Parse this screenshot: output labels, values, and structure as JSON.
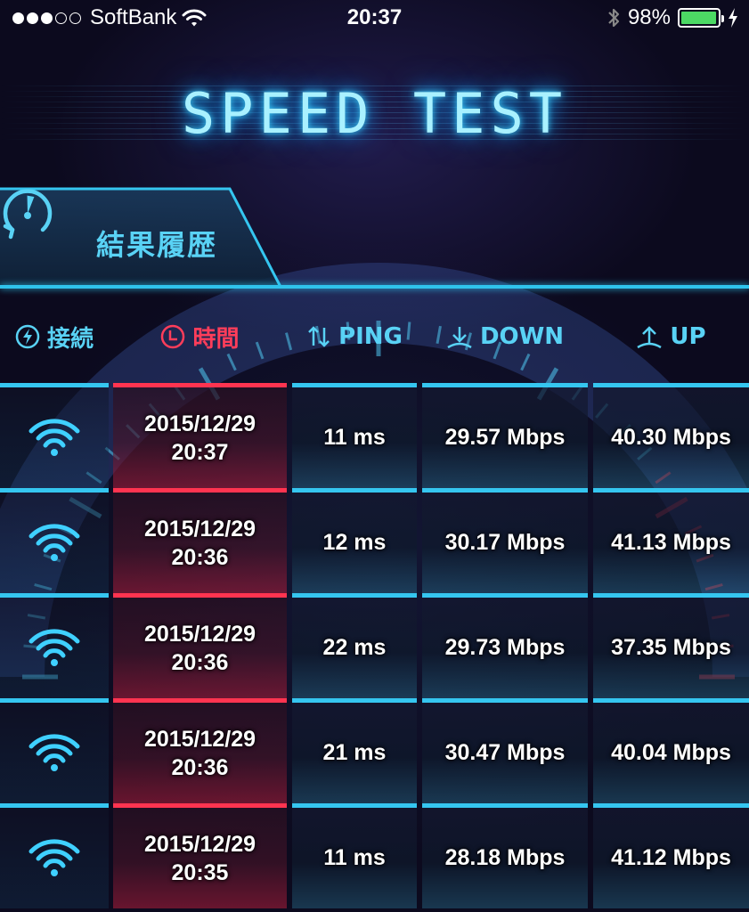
{
  "status_bar": {
    "carrier": "SoftBank",
    "time": "20:37",
    "battery": "98%",
    "battery_level": 0.98,
    "signal_bars": 3,
    "signal_total": 5,
    "icons": [
      "wifi-icon",
      "bluetooth-icon",
      "battery-icon",
      "charging-icon"
    ]
  },
  "title": "SPEED TEST",
  "history_tab": {
    "label": "結果履歴",
    "icon": "gauge-history-icon"
  },
  "columns": [
    {
      "label": "接続",
      "icon": "bolt-icon",
      "active": false
    },
    {
      "label": "時間",
      "icon": "clock-icon",
      "active": true
    },
    {
      "label": "PING",
      "icon": "updown-arrows-icon",
      "active": false
    },
    {
      "label": "DOWN",
      "icon": "download-arrow-icon",
      "active": false
    },
    {
      "label": "UP",
      "icon": "upload-arrow-icon",
      "active": false
    }
  ],
  "results": [
    {
      "connection": "wifi",
      "date": "2015/12/29",
      "time": "20:37",
      "ping": "11 ms",
      "down": "29.57 Mbps",
      "up": "40.30 Mbps"
    },
    {
      "connection": "wifi",
      "date": "2015/12/29",
      "time": "20:36",
      "ping": "12 ms",
      "down": "30.17 Mbps",
      "up": "41.13 Mbps"
    },
    {
      "connection": "wifi",
      "date": "2015/12/29",
      "time": "20:36",
      "ping": "22 ms",
      "down": "29.73 Mbps",
      "up": "37.35 Mbps"
    },
    {
      "connection": "wifi",
      "date": "2015/12/29",
      "time": "20:36",
      "ping": "21 ms",
      "down": "30.47 Mbps",
      "up": "40.04 Mbps"
    },
    {
      "connection": "wifi",
      "date": "2015/12/29",
      "time": "20:35",
      "ping": "11 ms",
      "down": "28.18 Mbps",
      "up": "41.12 Mbps"
    }
  ],
  "colors": {
    "accent": "#35c6f0",
    "active": "#ff3450",
    "background": "#0c0a1e",
    "battery": "#4cd964"
  }
}
